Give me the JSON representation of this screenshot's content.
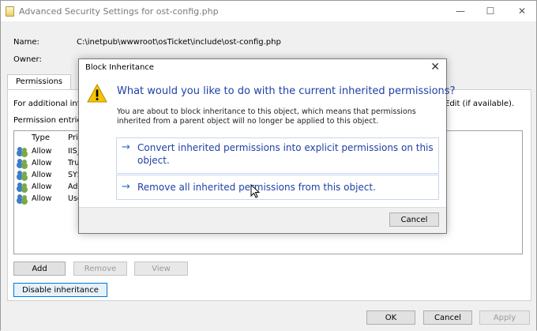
{
  "window": {
    "title": "Advanced Security Settings for ost-config.php",
    "minimize_glyph": "—",
    "maximize_glyph": "☐",
    "close_glyph": "✕"
  },
  "info": {
    "name_label": "Name:",
    "name_value": "C:\\inetpub\\wwwroot\\osTicket\\include\\ost-config.php",
    "owner_label": "Owner:"
  },
  "tabs": [
    {
      "label": "Permissions"
    }
  ],
  "panel": {
    "additional_info": "For additional infi",
    "edit_hint": "Edit (if available).",
    "entries_label": "Permission entrie"
  },
  "list": {
    "columns": [
      "Type",
      "Pri"
    ],
    "rows": [
      {
        "type": "Allow",
        "principal": "IIS_"
      },
      {
        "type": "Allow",
        "principal": "Tru"
      },
      {
        "type": "Allow",
        "principal": "SYS"
      },
      {
        "type": "Allow",
        "principal": "Adi"
      },
      {
        "type": "Allow",
        "principal": "Use"
      }
    ]
  },
  "buttons": {
    "add": "Add",
    "remove": "Remove",
    "view": "View",
    "disable_inheritance": "Disable inheritance",
    "ok": "OK",
    "cancel": "Cancel",
    "apply": "Apply"
  },
  "dialog": {
    "title": "Block Inheritance",
    "close_glyph": "✕",
    "heading": "What would you like to do with the current inherited permissions?",
    "description": "You are about to block inheritance to this object, which means that permissions inherited from a parent object will no longer be applied to this object.",
    "options": [
      {
        "arrow": "→",
        "label": "Convert inherited permissions into explicit permissions on this object."
      },
      {
        "arrow": "→",
        "label": "Remove all inherited permissions from this object."
      }
    ],
    "cancel": "Cancel"
  },
  "colors": {
    "accent": "#0078d7",
    "link_text": "#1f3fa8",
    "warning": "#f5c400"
  },
  "icons": {
    "window": "document-icon",
    "principal": "users-icon",
    "dialog": "warning-icon"
  }
}
